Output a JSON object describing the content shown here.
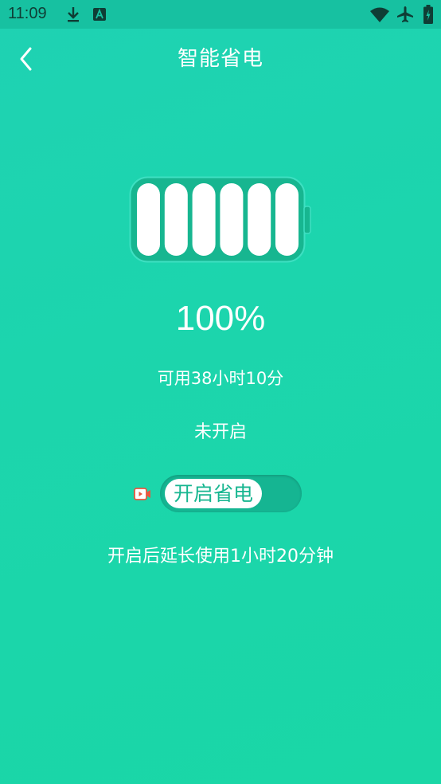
{
  "status_bar": {
    "time": "11:09",
    "icons": [
      "download-icon",
      "font-a-icon",
      "wifi-icon",
      "airplane-icon",
      "battery-charging-icon"
    ]
  },
  "header": {
    "title": "智能省电",
    "back_icon": "chevron-left-icon"
  },
  "battery": {
    "level_percent": 100,
    "bars_filled": 6,
    "bars_total": 6,
    "percent_label": "100%",
    "remaining_label": "可用38小时10分"
  },
  "power_saving": {
    "status_label": "未开启",
    "toggle_label": "开启省电",
    "enabled": false,
    "video_icon": "video-ad-icon",
    "extend_label": "开启后延长使用1小时20分钟"
  },
  "colors": {
    "background": "#1ad4ac",
    "status_bar": "#17c1a1",
    "battery_body": "#17b690",
    "toggle_track": "#15b592",
    "video_icon": "#e8573f"
  }
}
